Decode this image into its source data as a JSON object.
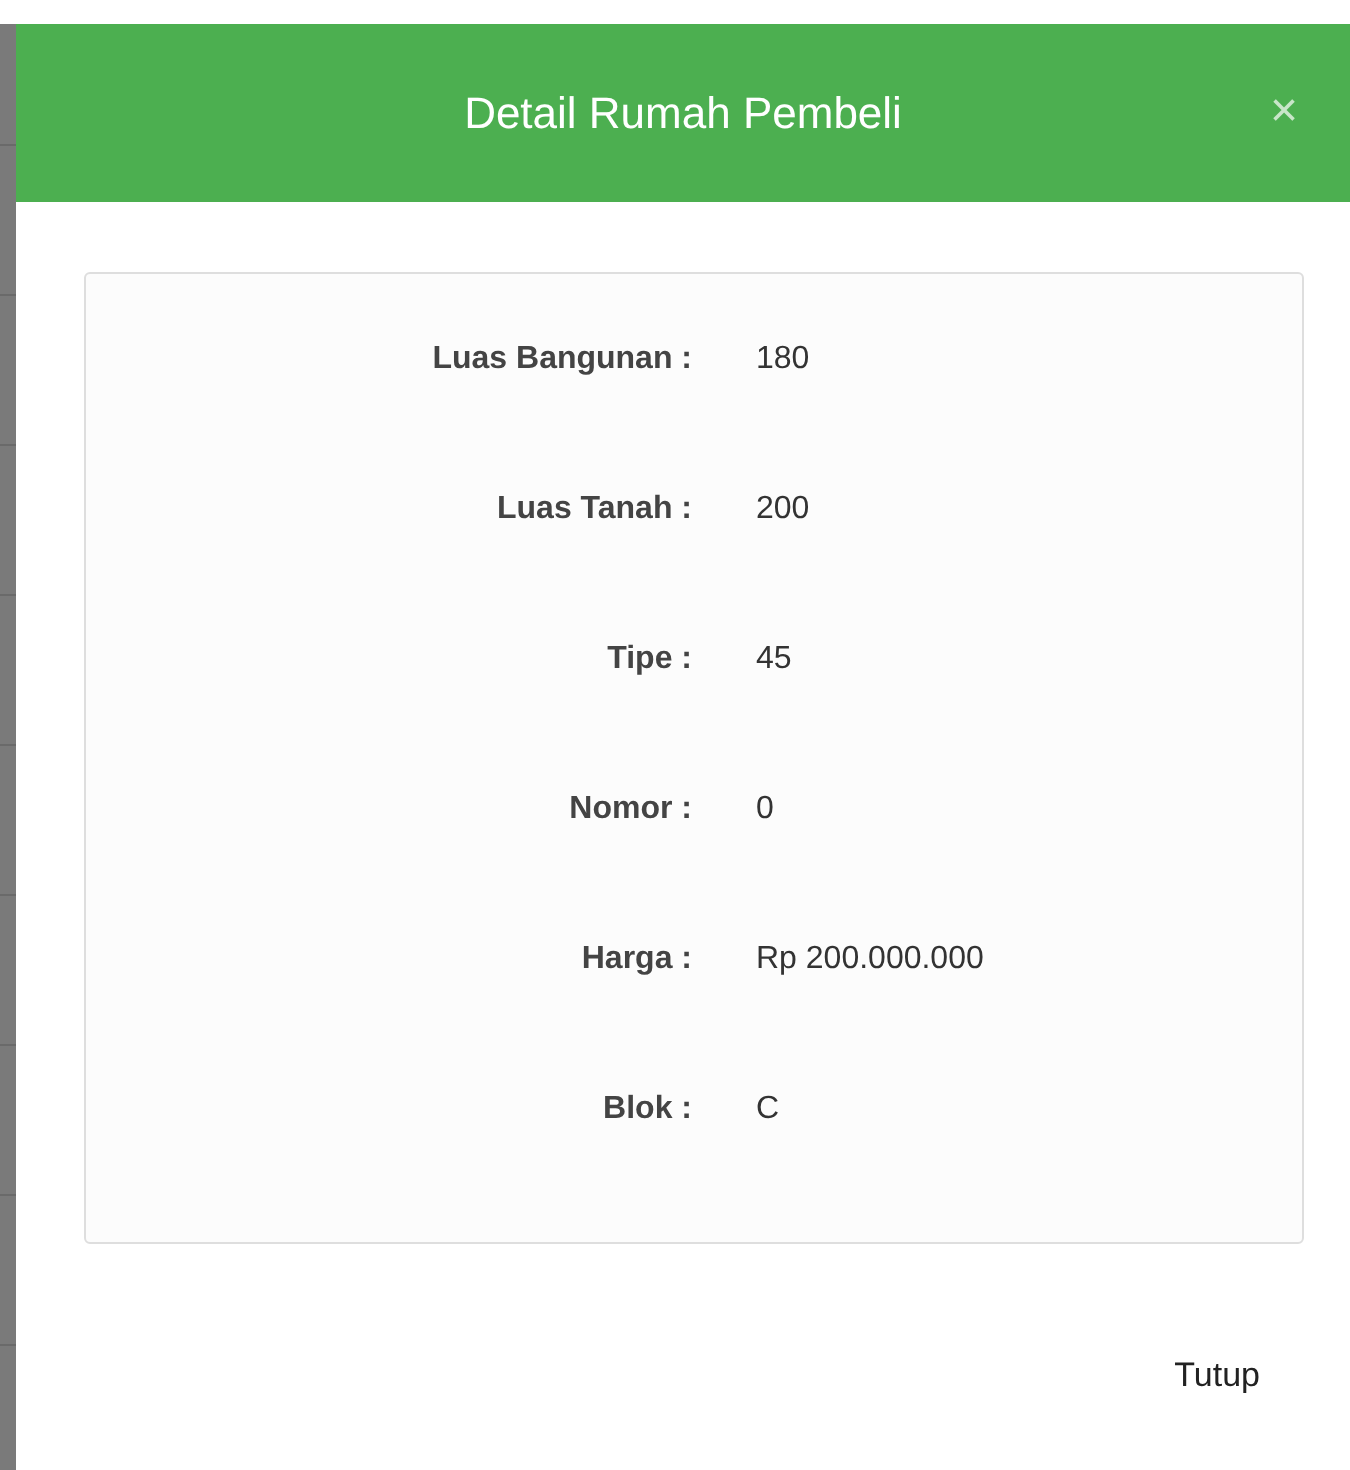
{
  "modal": {
    "title": "Detail Rumah Pembeli",
    "close": "×"
  },
  "details": [
    {
      "label": "Luas Bangunan :",
      "value": "180"
    },
    {
      "label": "Luas Tanah :",
      "value": "200"
    },
    {
      "label": "Tipe :",
      "value": "45"
    },
    {
      "label": "Nomor :",
      "value": "0"
    },
    {
      "label": "Harga :",
      "value": "Rp 200.000.000"
    },
    {
      "label": "Blok :",
      "value": "C"
    }
  ],
  "footer": {
    "button": "Tutup"
  }
}
